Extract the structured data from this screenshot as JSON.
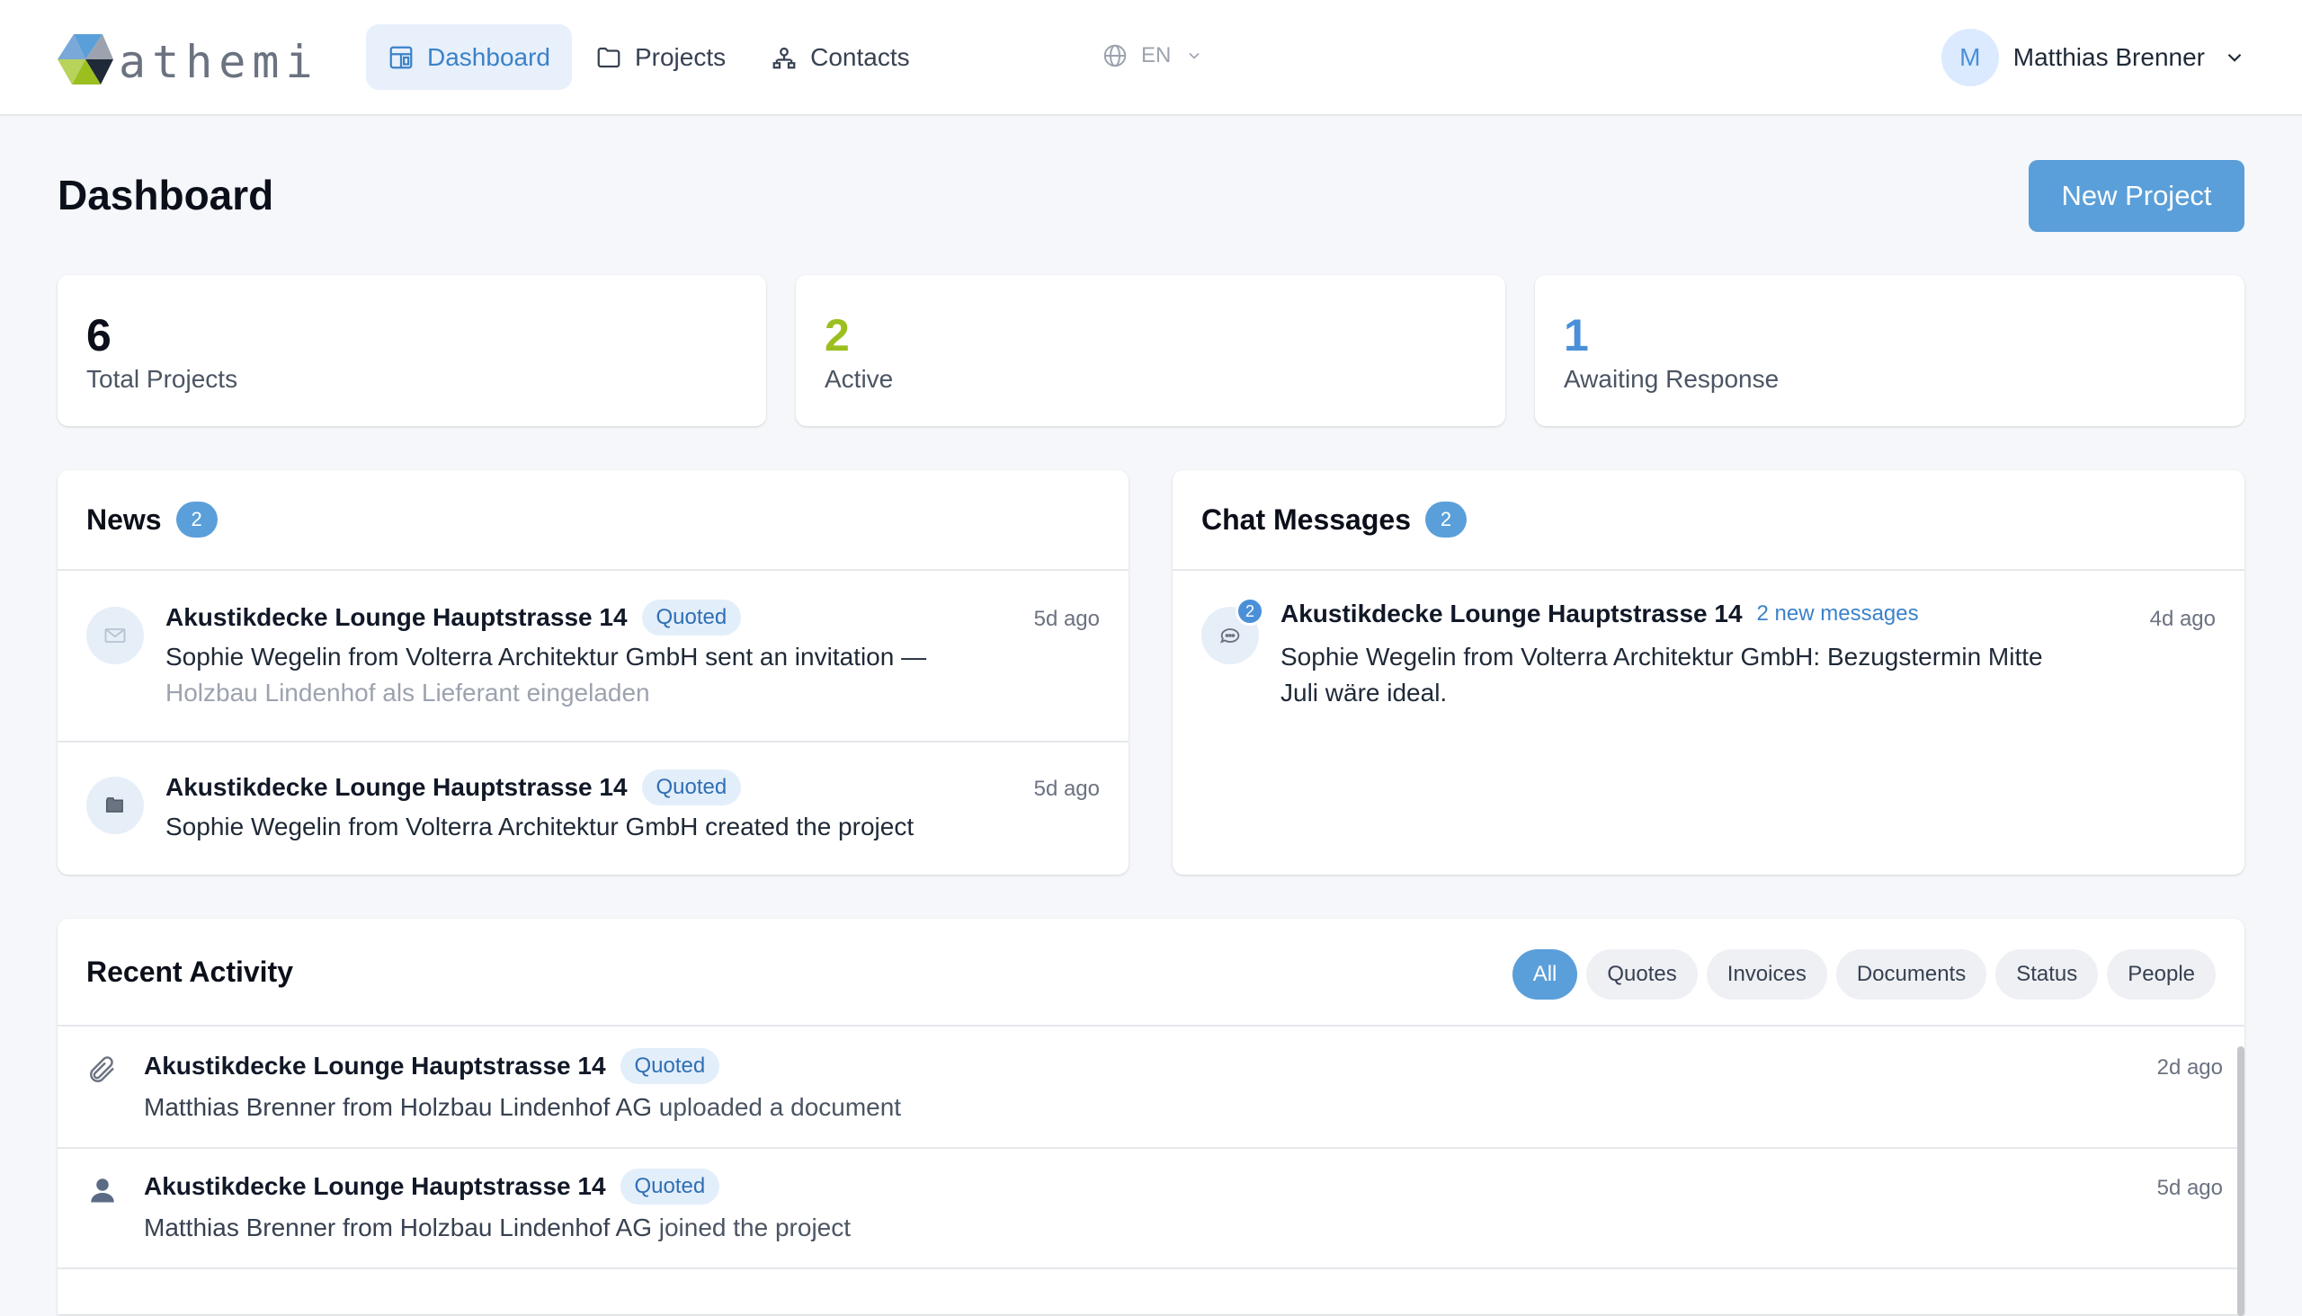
{
  "header": {
    "logo_text": "athemi",
    "nav": [
      {
        "label": "Dashboard",
        "icon": "dashboard-icon",
        "active": true
      },
      {
        "label": "Projects",
        "icon": "folder-icon",
        "active": false
      },
      {
        "label": "Contacts",
        "icon": "contacts-icon",
        "active": false
      }
    ],
    "language": "EN",
    "user": {
      "initial": "M",
      "name": "Matthias Brenner"
    }
  },
  "page": {
    "title": "Dashboard",
    "new_project_label": "New Project"
  },
  "stats": [
    {
      "value": "6",
      "label": "Total Projects",
      "color": "#0b0f19"
    },
    {
      "value": "2",
      "label": "Active",
      "color": "#9bbf1f"
    },
    {
      "value": "1",
      "label": "Awaiting Response",
      "color": "#4a90d9"
    }
  ],
  "news": {
    "title": "News",
    "count": "2",
    "items": [
      {
        "icon": "envelope-icon",
        "project": "Akustikdecke Lounge Hauptstrasse 14",
        "status": "Quoted",
        "text": "Sophie Wegelin from Volterra Architektur GmbH sent an invitation —",
        "subtext": "Holzbau Lindenhof als Lieferant eingeladen",
        "time": "5d ago"
      },
      {
        "icon": "folder-icon",
        "project": "Akustikdecke Lounge Hauptstrasse 14",
        "status": "Quoted",
        "text": "Sophie Wegelin from Volterra Architektur GmbH created the project",
        "time": "5d ago"
      }
    ]
  },
  "chat": {
    "title": "Chat Messages",
    "count": "2",
    "items": [
      {
        "icon": "chat-bubble-icon",
        "unread": "2",
        "project": "Akustikdecke Lounge Hauptstrasse 14",
        "new_messages": "2 new messages",
        "line1": "Sophie Wegelin from Volterra Architektur GmbH: Bezugstermin Mitte",
        "line2": "Juli wäre ideal.",
        "time": "4d ago"
      }
    ]
  },
  "activity": {
    "title": "Recent Activity",
    "filters": [
      "All",
      "Quotes",
      "Invoices",
      "Documents",
      "Status",
      "People"
    ],
    "active_filter": "All",
    "items": [
      {
        "icon": "paperclip-icon",
        "project": "Akustikdecke Lounge Hauptstrasse 14",
        "status": "Quoted",
        "actor": "Matthias Brenner from Holzbau Lindenhof AG",
        "action": "uploaded a document",
        "time": "2d ago"
      },
      {
        "icon": "person-icon",
        "project": "Akustikdecke Lounge Hauptstrasse 14",
        "status": "Quoted",
        "actor": "Matthias Brenner from Holzbau Lindenhof AG",
        "action": "joined the project",
        "time": "5d ago"
      }
    ]
  }
}
